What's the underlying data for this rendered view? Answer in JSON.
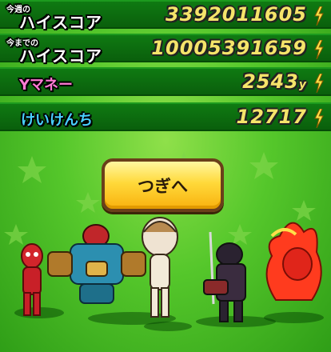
{
  "scores": [
    {
      "label_prefix": "今週の",
      "label": "ハイスコア",
      "value": "3392011605"
    },
    {
      "label_prefix": "今までの",
      "label": "ハイスコア",
      "value": "10005391659"
    }
  ],
  "money": {
    "label": "Yマネー",
    "value": "2543",
    "unit": "y"
  },
  "exp": {
    "label": "けいけんち",
    "value": "12717"
  },
  "next_button": {
    "label": "つぎへ"
  },
  "colors": {
    "background": "#55c72b",
    "row": "#0f7a12",
    "value": "#f5e46a",
    "button": "#ffd93a"
  }
}
